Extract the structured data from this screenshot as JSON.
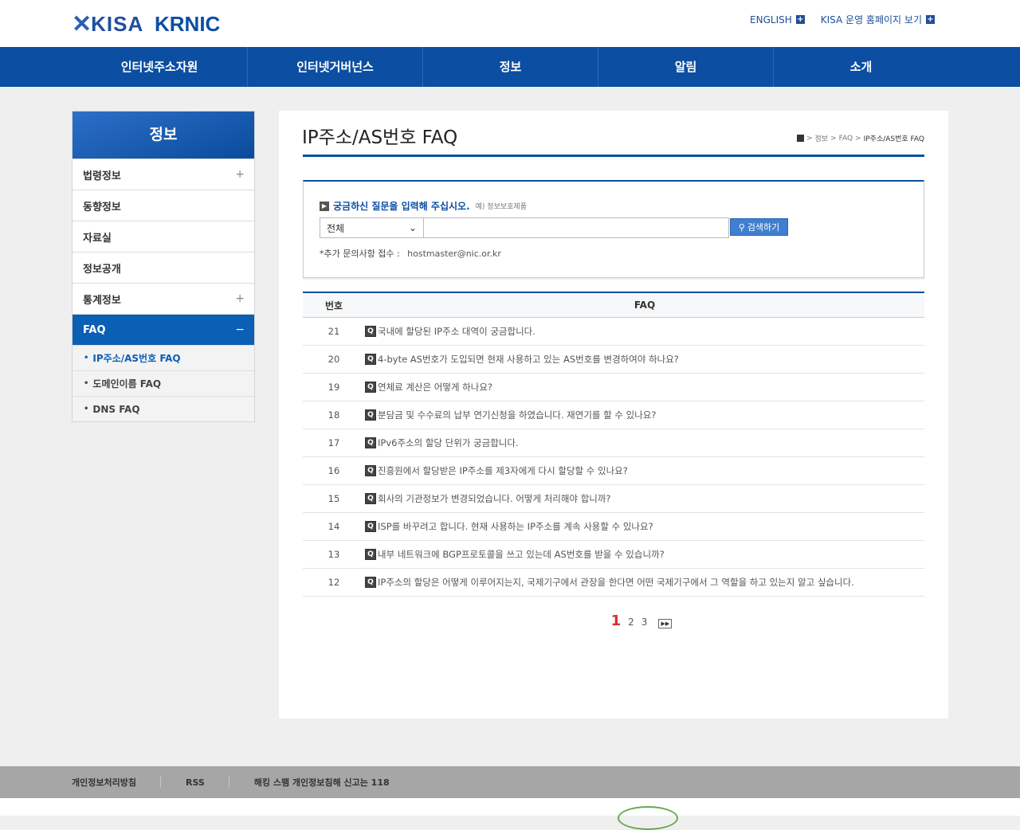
{
  "header": {
    "logo_kisa": "KISA",
    "logo_krnic": "KRNIC",
    "links": [
      "ENGLISH",
      "KISA 운영 홈페이지 보기"
    ]
  },
  "gnb": [
    "인터넷주소자원",
    "인터넷거버넌스",
    "정보",
    "알림",
    "소개"
  ],
  "lnb": {
    "title": "정보",
    "items": [
      {
        "label": "법령정보",
        "mark": "+"
      },
      {
        "label": "동향정보",
        "mark": ""
      },
      {
        "label": "자료실",
        "mark": ""
      },
      {
        "label": "정보공개",
        "mark": ""
      },
      {
        "label": "통계정보",
        "mark": "+"
      },
      {
        "label": "FAQ",
        "mark": "−"
      }
    ],
    "sub": [
      "IP주소/AS번호 FAQ",
      "도메인이름 FAQ",
      "DNS FAQ"
    ]
  },
  "page": {
    "title": "IP주소/AS번호 FAQ",
    "breadcrumb": [
      "정보",
      "FAQ",
      "IP주소/AS번호 FAQ"
    ]
  },
  "search": {
    "prompt": "궁금하신 질문을 입력해 주십시오.",
    "example": "예) 정보보호제품",
    "select_value": "전체",
    "input_value": "",
    "button": "검색하기",
    "note": "*추가 문의사항 접수 :",
    "email": "hostmaster@nic.or.kr"
  },
  "table": {
    "headers": [
      "번호",
      "FAQ"
    ],
    "rows": [
      {
        "num": "21",
        "q": "국내에 할당된 IP주소 대역이 궁금합니다."
      },
      {
        "num": "20",
        "q": "4-byte AS번호가 도입되면 현재 사용하고 있는 AS번호를 변경하여야 하나요?"
      },
      {
        "num": "19",
        "q": "연체료 계산은 어떻게 하나요?"
      },
      {
        "num": "18",
        "q": "분담금 및 수수료의 납부 연기신청을 하였습니다. 재연기를 할 수 있나요?"
      },
      {
        "num": "17",
        "q": "IPv6주소의 할당 단위가 궁금합니다."
      },
      {
        "num": "16",
        "q": "진흥원에서 할당받은 IP주소를 제3자에게 다시 할당할 수 있나요?"
      },
      {
        "num": "15",
        "q": "회사의 기관정보가 변경되었습니다. 어떻게 처리해야 합니까?"
      },
      {
        "num": "14",
        "q": "ISP를 바꾸려고 합니다. 현재 사용하는 IP주소를 계속 사용할 수 있나요?"
      },
      {
        "num": "13",
        "q": "내부 네트워크에 BGP프로토콜을 쓰고 있는데 AS번호를 받을 수 있습니까?"
      },
      {
        "num": "12",
        "q": "IP주소의 할당은 어떻게 이루어지는지, 국제기구에서 관장을 한다면 어떤 국제기구에서 그 역할을 하고 있는지 알고 싶습니다."
      }
    ],
    "q_icon": "Q"
  },
  "pager": {
    "current": "1",
    "pages": [
      "2",
      "3"
    ]
  },
  "footer": [
    "개인정보처리방침",
    "RSS",
    "해킹 스팸 개인정보침해 신고는 118"
  ]
}
